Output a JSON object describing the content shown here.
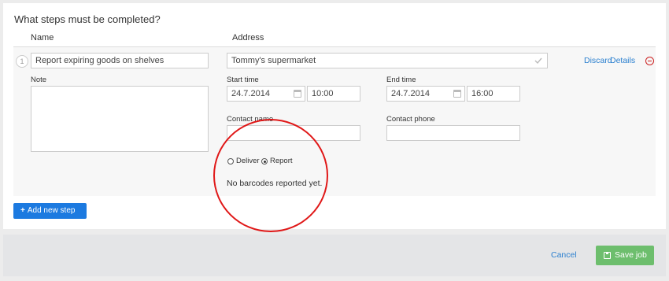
{
  "steps_section": {
    "heading": "What steps must be completed?",
    "name_col": "Name",
    "address_col": "Address"
  },
  "step": {
    "number": "1",
    "name_value": "Report expiring goods on shelves",
    "address_value": "Tommy's supermarket",
    "discard_link": "Discard",
    "details_link": "Details",
    "note_label": "Note",
    "start_time_label": "Start time",
    "start_date": "24.7.2014",
    "start_hour": "10:00",
    "end_time_label": "End time",
    "end_date": "24.7.2014",
    "end_hour": "16:00",
    "contact_name_label": "Contact name",
    "contact_name_value": "",
    "contact_phone_label": "Contact phone",
    "contact_phone_value": "",
    "radio_deliver": "Deliver",
    "radio_report": "Report",
    "selected_type": "Report",
    "barcode_message": "No barcodes reported yet."
  },
  "add_step_button": "Add new step",
  "footer": {
    "cancel_label": "Cancel",
    "save_label": "Save job"
  },
  "colors": {
    "primary_button": "#1c7ae0",
    "save_button": "#6dbe6d",
    "link": "#2a7fcf",
    "annotation_circle": "#e01818",
    "remove_icon": "#cc2222"
  },
  "icons": [
    "check-icon",
    "calendar-icon",
    "remove-circle-icon",
    "plus-icon",
    "save-icon"
  ]
}
